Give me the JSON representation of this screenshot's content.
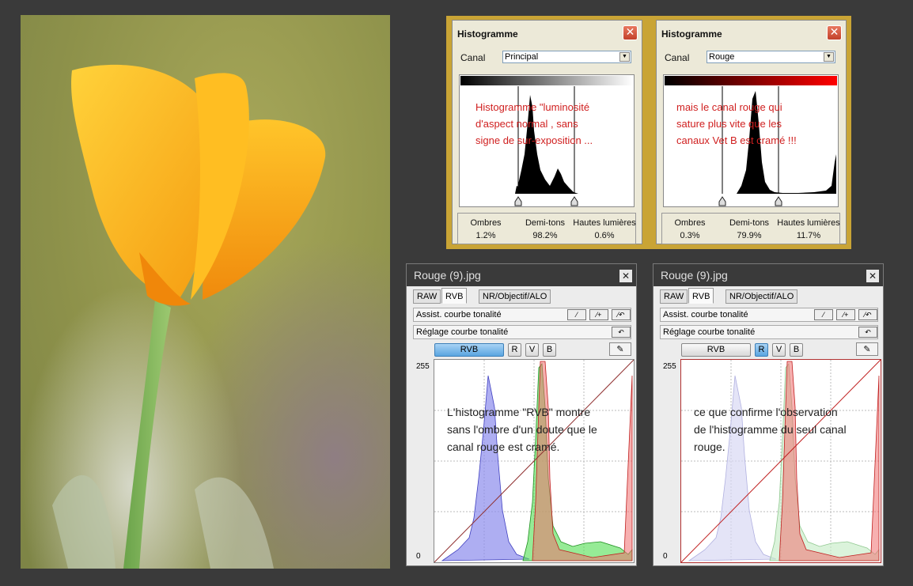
{
  "histogram_windows": [
    {
      "title": "Histogramme",
      "canal_label": "Canal",
      "canal_value": "Principal",
      "annotation": "Histogramme \"luminosité\nd'aspect normal , sans\nsigne de sur-exposition ...",
      "stats": [
        {
          "label": "Ombres",
          "value": "1.2%"
        },
        {
          "label": "Demi-tons",
          "value": "98.2%"
        },
        {
          "label": "Hautes lumières",
          "value": "0.6%"
        }
      ]
    },
    {
      "title": "Histogramme",
      "canal_label": "Canal",
      "canal_value": "Rouge",
      "annotation": "mais le canal rouge qui\nsature plus vite que les\ncanaux Vet B est cramé !!!",
      "stats": [
        {
          "label": "Ombres",
          "value": "0.3%"
        },
        {
          "label": "Demi-tons",
          "value": "79.9%"
        },
        {
          "label": "Hautes lumières",
          "value": "11.7%"
        }
      ]
    }
  ],
  "curve_windows": [
    {
      "title": "Rouge  (9).jpg",
      "tabs": [
        "RAW",
        "RVB",
        "NR/Objectif/ALO"
      ],
      "active_tab": "RVB",
      "assist_label": "Assist. courbe tonalité",
      "reglage_label": "Réglage courbe tonalité",
      "channels": [
        "RVB",
        "R",
        "V",
        "B"
      ],
      "active_channel": "RVB",
      "axis_max": "255",
      "axis_min": "0",
      "annotation": "L'histogramme \"RVB\" montre\nsans l'ombre d'un doute que le\ncanal rouge est cramé."
    },
    {
      "title": "Rouge  (9).jpg",
      "tabs": [
        "RAW",
        "RVB",
        "NR/Objectif/ALO"
      ],
      "active_tab": "RVB",
      "assist_label": "Assist. courbe tonalité",
      "reglage_label": "Réglage courbe tonalité",
      "channels": [
        "RVB",
        "R",
        "V",
        "B"
      ],
      "active_channel": "R",
      "axis_max": "255",
      "axis_min": "0",
      "annotation": "ce que confirme l'observation\nde l'histogramme du seul canal\nrouge."
    }
  ],
  "icons": {
    "close": "close-icon",
    "eyedropper": "eyedropper-icon",
    "reset": "reset-icon",
    "curve_linear": "curve-linear-icon",
    "curve_add": "curve-add-icon",
    "curve_auto": "curve-auto-icon"
  },
  "colors": {
    "panel_gold": "#c9a435",
    "annotation_red": "#d02020",
    "red_channel": "#e23b3b",
    "green_channel": "#3fcf3f",
    "blue_channel": "#8080e8"
  }
}
